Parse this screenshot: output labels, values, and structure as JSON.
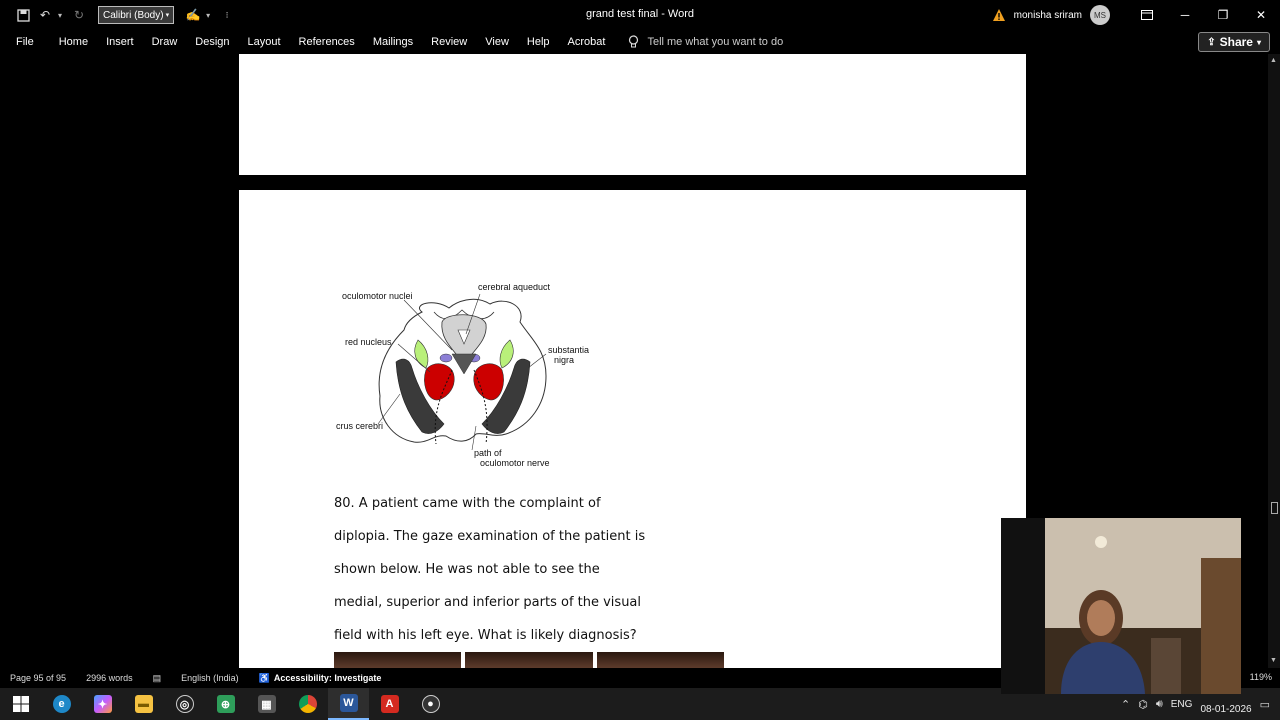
{
  "titlebar": {
    "font_box": "Calibri (Body)",
    "document_title": "grand test final  -  Word",
    "user_name": "monisha sriram",
    "avatar_initials": "MS"
  },
  "ribbon": {
    "tabs": [
      "File",
      "Home",
      "Insert",
      "Draw",
      "Design",
      "Layout",
      "References",
      "Mailings",
      "Review",
      "View",
      "Help",
      "Acrobat"
    ],
    "tell_me": "Tell me what you want to do",
    "share_label": "Share"
  },
  "diagram": {
    "labels": {
      "oculomotor_nuclei": "oculomotor nuclei",
      "cerebral_aqueduct": "cerebral aqueduct",
      "red_nucleus": "red nucleus",
      "substantia": "substantia",
      "nigra": "nigra",
      "crus_cerebri": "crus cerebri",
      "path_of": "path of",
      "oculomotor_nerve": "oculomotor nerve"
    }
  },
  "question": {
    "lines": [
      "80. A patient came with the complaint of",
      "diplopia. The gaze examination of the patient is",
      "shown below. He was not able to see the",
      "medial, superior and inferior parts of the visual",
      "field with his left eye. What is likely diagnosis?"
    ]
  },
  "statusbar": {
    "page": "Page 95 of 95",
    "words": "2996 words",
    "language": "English (India)",
    "accessibility": "Accessibility: Investigate",
    "zoom": "119%"
  },
  "tray": {
    "language": "ENG",
    "date": "08-01-2026"
  },
  "colors": {
    "red_nucleus": "#cc0000",
    "substantia_nigra_band": "#3a3a3a",
    "oculomotor_nuclei": "#8c7fd6",
    "green_structure": "#b9f07a",
    "word_accent": "#2b579a"
  }
}
